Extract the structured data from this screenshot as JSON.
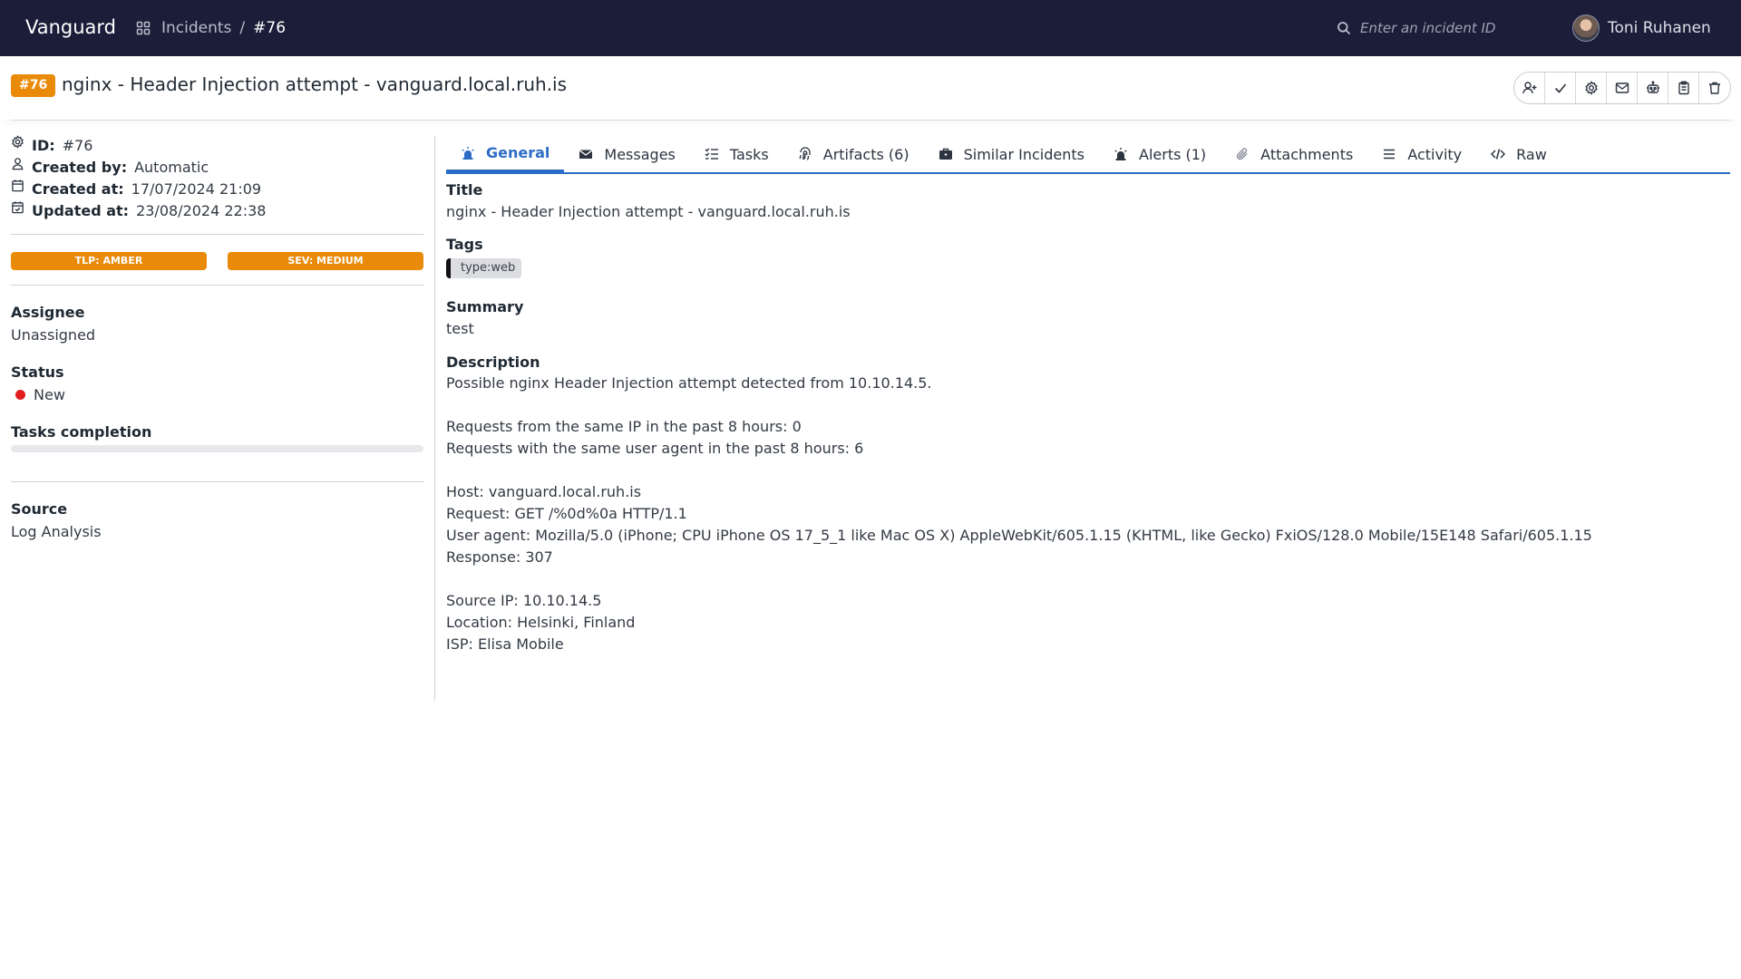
{
  "navbar": {
    "brand": "Vanguard",
    "breadcrumb": {
      "section": "Incidents",
      "separator": "/",
      "current": "#76"
    },
    "search_placeholder": "Enter an incident ID",
    "user_name": "Toni Ruhanen"
  },
  "incident": {
    "badge": "#76",
    "title": "nginx - Header Injection attempt - vanguard.local.ruh.is"
  },
  "actions": [
    "assign-user-icon",
    "check-icon",
    "gear-icon",
    "mail-icon",
    "robot-icon",
    "clipboard-icon",
    "trash-icon"
  ],
  "meta": {
    "id_label": "ID:",
    "id_value": "#76",
    "created_by_label": "Created by:",
    "created_by_value": "Automatic",
    "created_at_label": "Created at:",
    "created_at_value": "17/07/2024 21:09",
    "updated_at_label": "Updated at:",
    "updated_at_value": "23/08/2024 22:38"
  },
  "pills": {
    "tlp": "TLP: AMBER",
    "sev": "SEV: MEDIUM"
  },
  "sidebar": {
    "assignee_label": "Assignee",
    "assignee_value": "Unassigned",
    "status_label": "Status",
    "status_value": "New",
    "tasks_label": "Tasks completion",
    "tasks_progress": 0,
    "source_label": "Source",
    "source_value": "Log Analysis"
  },
  "tabs": [
    {
      "label": "General",
      "icon": "siren-icon",
      "active": true
    },
    {
      "label": "Messages",
      "icon": "envelope-icon"
    },
    {
      "label": "Tasks",
      "icon": "tasklist-icon"
    },
    {
      "label": "Artifacts (6)",
      "icon": "fingerprint-icon"
    },
    {
      "label": "Similar Incidents",
      "icon": "briefcase-icon"
    },
    {
      "label": "Alerts (1)",
      "icon": "alarm-icon"
    },
    {
      "label": "Attachments",
      "icon": "paperclip-icon"
    },
    {
      "label": "Activity",
      "icon": "list-icon"
    },
    {
      "label": "Raw",
      "icon": "code-icon"
    }
  ],
  "general": {
    "title_label": "Title",
    "title_value": "nginx - Header Injection attempt - vanguard.local.ruh.is",
    "tags_label": "Tags",
    "tag": "type:web",
    "summary_label": "Summary",
    "summary_value": "test",
    "description_label": "Description",
    "description_lines": [
      "Possible nginx Header Injection attempt detected from 10.10.14.5.",
      "",
      "Requests from the same IP in the past 8 hours: 0",
      "Requests with the same user agent in the past 8 hours: 6",
      "",
      "Host: vanguard.local.ruh.is",
      "Request: GET /%0d%0a HTTP/1.1",
      "User agent: Mozilla/5.0 (iPhone; CPU iPhone OS 17_5_1 like Mac OS X) AppleWebKit/605.1.15 (KHTML, like Gecko) FxiOS/128.0 Mobile/15E148 Safari/605.1.15",
      "Response: 307",
      "",
      "Source IP: 10.10.14.5",
      "Location: Helsinki, Finland",
      "ISP: Elisa Mobile"
    ]
  },
  "colors": {
    "navbar": "#1c1d38",
    "accent_orange": "#e98a09",
    "tab_active": "#2d6cc6",
    "status_new": "#e01e1e"
  }
}
